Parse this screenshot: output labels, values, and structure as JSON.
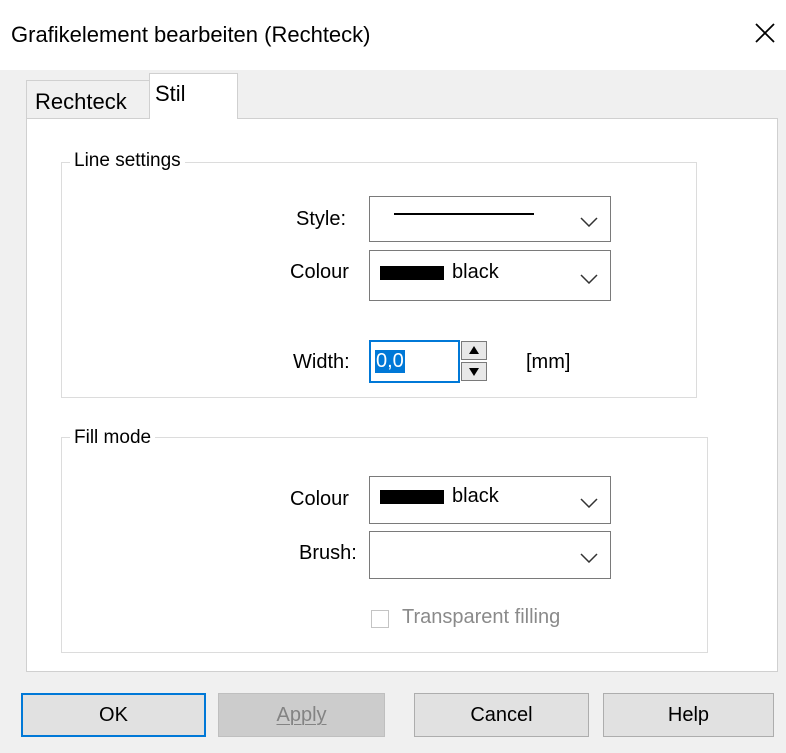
{
  "window": {
    "title": "Grafikelement bearbeiten (Rechteck)",
    "close_icon": "close-icon"
  },
  "tabs": [
    {
      "label": "Rechteck",
      "active": false
    },
    {
      "label": "Stil",
      "active": true
    }
  ],
  "line_settings": {
    "legend": "Line settings",
    "style_label": "Style:",
    "style_value": "solid-line",
    "colour_label": "Colour",
    "colour_value": "black",
    "colour_hex": "#000000",
    "width_label": "Width:",
    "width_value": "0,0",
    "width_unit": "[mm]"
  },
  "fill_mode": {
    "legend": "Fill mode",
    "colour_label": "Colour",
    "colour_value": "black",
    "colour_hex": "#000000",
    "brush_label": "Brush:",
    "brush_value": "",
    "transparent_label": "Transparent filling",
    "transparent_checked": false,
    "transparent_enabled": false
  },
  "buttons": {
    "ok": "OK",
    "apply": "Apply",
    "cancel": "Cancel",
    "help": "Help"
  },
  "colors": {
    "accent": "#0078d7",
    "panel_bg": "#ffffff",
    "window_bg": "#f0f0f0"
  }
}
